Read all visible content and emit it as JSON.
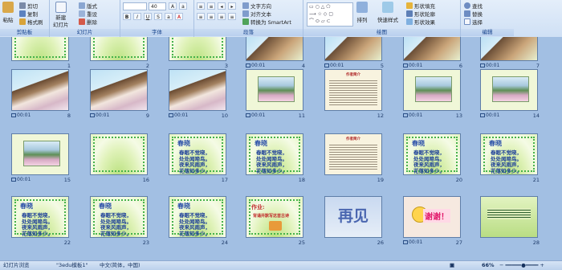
{
  "ribbon": {
    "groups": [
      {
        "key": "clipboard",
        "label": "剪贴板",
        "buttons": {
          "paste": "粘贴",
          "cut": "剪切",
          "copy": "复制",
          "format_painter": "格式刷"
        }
      },
      {
        "key": "slides",
        "label": "幻灯片",
        "buttons": {
          "new_slide_1": "新建",
          "new_slide_2": "幻灯片",
          "layout": "版式",
          "reset": "重设",
          "delete": "删除"
        }
      },
      {
        "key": "font",
        "label": "字体",
        "font_size": "40"
      },
      {
        "key": "paragraph",
        "label": "段落",
        "buttons": {
          "text_direction": "文字方向",
          "align_text": "对齐文本",
          "convert_smartart": "转换为 SmartArt"
        }
      },
      {
        "key": "drawing",
        "label": "绘图",
        "buttons": {
          "arrange": "排列",
          "quick_styles": "快速样式",
          "shape_fill": "形状填充",
          "shape_outline": "形状轮廓",
          "shape_effects": "形状效果"
        }
      },
      {
        "key": "editing",
        "label": "编辑",
        "buttons": {
          "find": "查找",
          "replace": "替换",
          "select": "选择"
        }
      }
    ]
  },
  "slides": [
    {
      "num": "1",
      "kind": "green",
      "partial": true
    },
    {
      "num": "2",
      "kind": "green",
      "partial": true
    },
    {
      "num": "3",
      "kind": "green",
      "partial": true
    },
    {
      "num": "4",
      "kind": "pav",
      "partial": true,
      "time": "00:01"
    },
    {
      "num": "5",
      "kind": "pav",
      "partial": true,
      "time": "00:01"
    },
    {
      "num": "6",
      "kind": "pav",
      "partial": true,
      "time": "00:01"
    },
    {
      "num": "7",
      "kind": "pav",
      "partial": true,
      "time": "00:01"
    },
    {
      "num": "8",
      "kind": "lady",
      "time": "00:01"
    },
    {
      "num": "9",
      "kind": "lady",
      "time": "00:01"
    },
    {
      "num": "10",
      "kind": "lady",
      "time": "00:01"
    },
    {
      "num": "11",
      "kind": "lake",
      "time": "00:01"
    },
    {
      "num": "12",
      "kind": "text",
      "title": "作者简介"
    },
    {
      "num": "13",
      "kind": "lake",
      "time": "00:01"
    },
    {
      "num": "14",
      "kind": "lake",
      "time": "00:01"
    },
    {
      "num": "15",
      "kind": "lake",
      "time": "00:01"
    },
    {
      "num": "16",
      "kind": "green"
    },
    {
      "num": "17",
      "kind": "poem",
      "title": "春晓",
      "lines": [
        "春眠不觉晓，",
        "处处闻啼鸟。",
        "夜来风雨声，",
        "花落知多少。"
      ]
    },
    {
      "num": "18",
      "kind": "poem",
      "title": "春晓",
      "lines": [
        "春眠不觉晓，",
        "处处闻啼鸟。",
        "夜来风雨声，",
        "花落知多少。"
      ]
    },
    {
      "num": "19",
      "kind": "text",
      "title": "作者简介"
    },
    {
      "num": "20",
      "kind": "poem",
      "title": "春晓",
      "lines": [
        "春眠不觉晓，",
        "处处闻啼鸟。",
        "夜来风雨声，",
        "花落知多少。"
      ]
    },
    {
      "num": "21",
      "kind": "poem",
      "title": "春晓",
      "lines": [
        "春眠不觉晓，",
        "处处闻啼鸟。",
        "夜来风雨声，",
        "花落知多少。"
      ]
    },
    {
      "num": "22",
      "kind": "poem",
      "title": "春晓",
      "lines": [
        "春眠不觉晓，",
        "处处闻啼鸟。",
        "夜来风雨声，",
        "花落知多少。"
      ]
    },
    {
      "num": "23",
      "kind": "poem",
      "title": "春晓",
      "lines": [
        "春眠不觉晓，",
        "处处闻啼鸟。",
        "夜来风雨声，",
        "花落知多少。"
      ]
    },
    {
      "num": "24",
      "kind": "poem",
      "title": "春晓",
      "lines": [
        "春眠不觉晓，",
        "处处闻啼鸟。",
        "夜来风雨声，",
        "花落知多少。"
      ]
    },
    {
      "num": "25",
      "kind": "homework",
      "title": "作业:",
      "subtitle": "背诵并默写这首古诗"
    },
    {
      "num": "26",
      "kind": "bye",
      "title": "再见"
    },
    {
      "num": "27",
      "kind": "thx",
      "title": "谢谢！",
      "time": "00:01"
    },
    {
      "num": "28",
      "kind": "end"
    }
  ],
  "status": {
    "view": "幻灯片浏览",
    "theme": "\"3edu模板1\"",
    "language": "中文(简体，中国)",
    "zoom": "66%"
  }
}
